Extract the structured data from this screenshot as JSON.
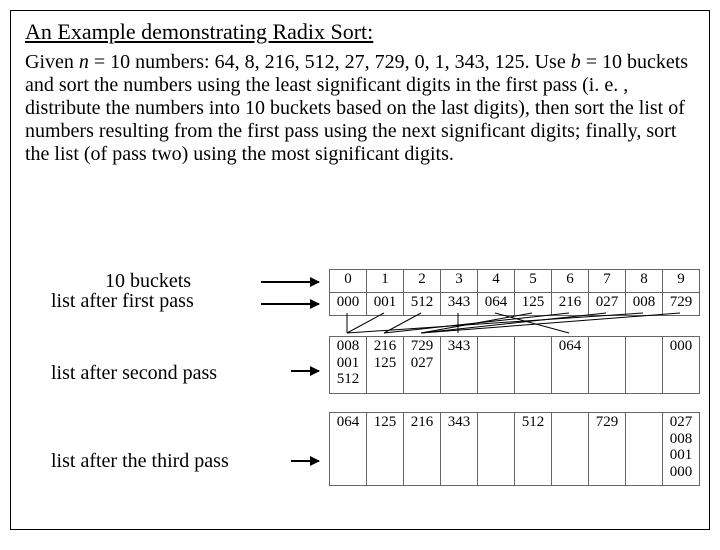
{
  "title": "An Example demonstrating Radix Sort:",
  "description": "Given <span class=ital>n</span> = 10 numbers: 64, 8, 216, 512, 27, 729, 0, 1, 343, 125. Use <span class=ital>b</span> = 10 buckets and sort the numbers using the least significant digits in the first pass (i. e. , distribute the numbers into 10 buckets based on the last digits), then sort the list of numbers resulting from the first pass using the next significant digits; finally, sort the list (of pass two) using the most significant digits.",
  "labels": {
    "buckets": "10 buckets",
    "pass1": "list after first pass",
    "pass2": "list after second pass",
    "pass3": "list after the third pass"
  },
  "buckets_header": [
    "0",
    "1",
    "2",
    "3",
    "4",
    "5",
    "6",
    "7",
    "8",
    "9"
  ],
  "pass1": [
    "000",
    "001",
    "512",
    "343",
    "064",
    "125",
    "216",
    "027",
    "008",
    "729"
  ],
  "pass2": [
    [
      "008",
      "001",
      "512"
    ],
    [
      "216",
      "125"
    ],
    [
      "729",
      "027"
    ],
    [
      "343"
    ],
    [],
    [],
    [
      "064"
    ],
    [],
    [],
    [
      "000"
    ]
  ],
  "pass3": [
    [
      "064"
    ],
    [
      "125"
    ],
    [
      "216"
    ],
    [
      "343"
    ],
    [],
    [
      "512"
    ],
    [],
    [
      "729"
    ],
    [],
    [
      "027",
      "008",
      "001",
      "000"
    ]
  ]
}
